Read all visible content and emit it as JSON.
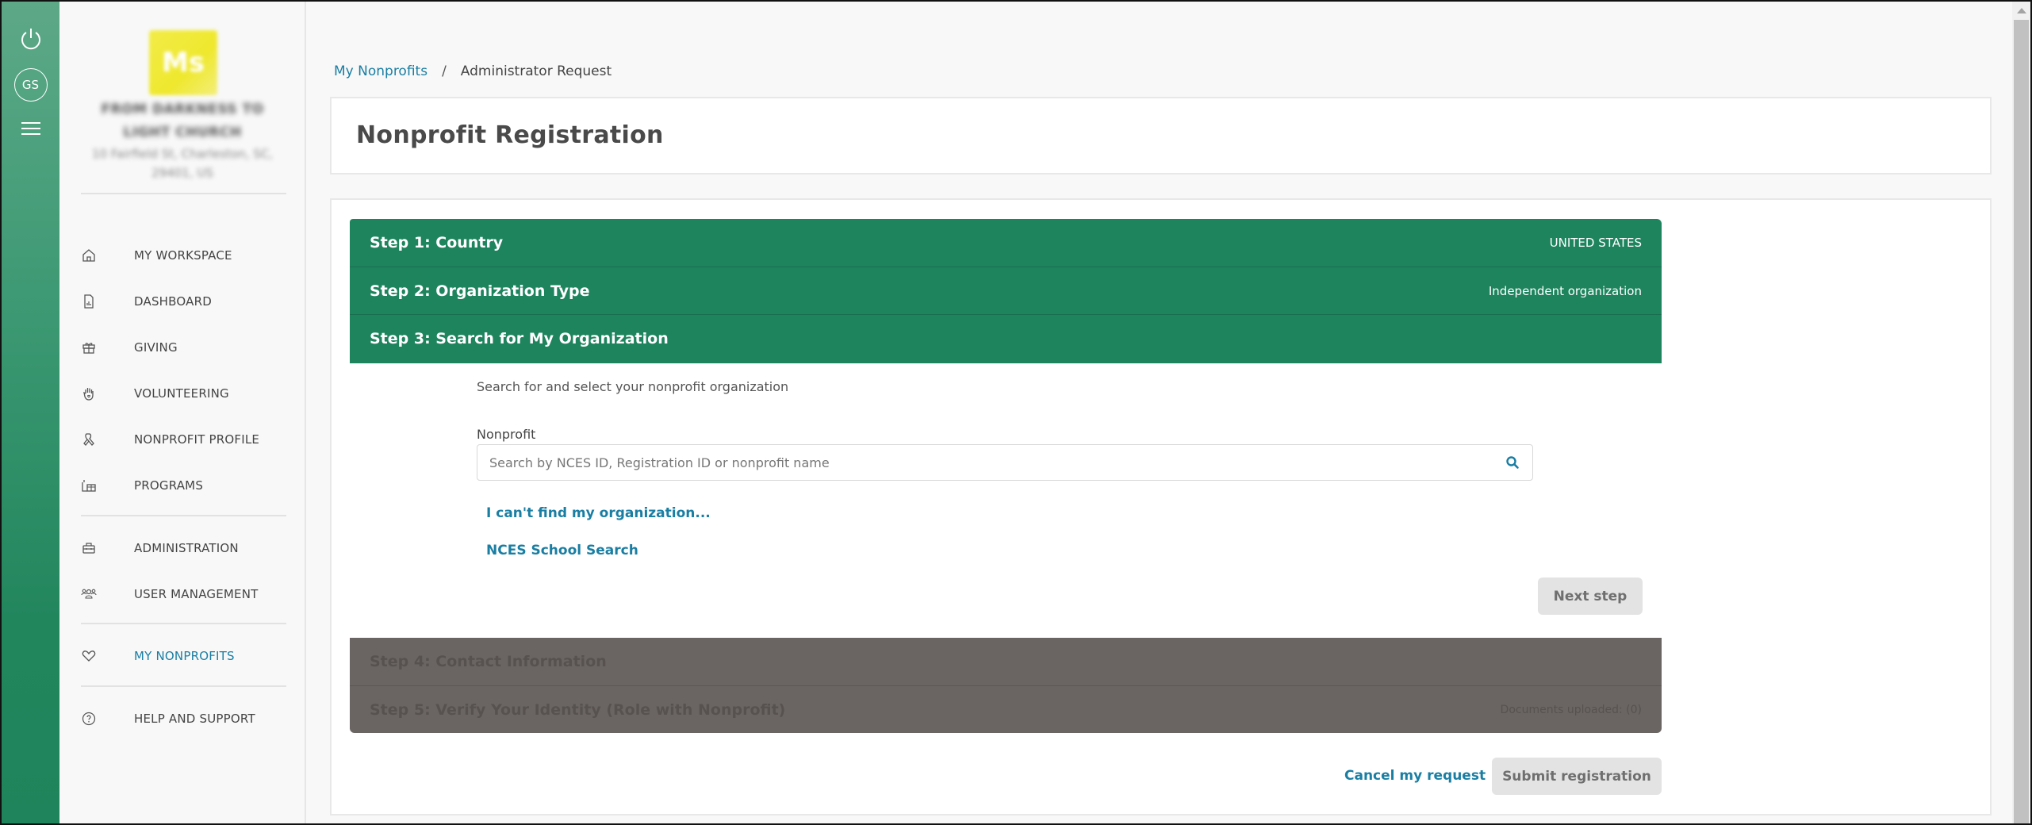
{
  "rail": {
    "avatar_initials": "GS",
    "icons": [
      "power-icon",
      "avatar",
      "hamburger-menu-icon"
    ]
  },
  "sidebar": {
    "org": {
      "logo_glyph": "Ms",
      "name": "FROM DARKNESS TO LIGHT CHURCH",
      "address": "10 Fairfield St, Charleston, SC, 29401, US"
    },
    "items": [
      {
        "label": "MY WORKSPACE",
        "icon": "home-icon",
        "active": false
      },
      {
        "label": "DASHBOARD",
        "icon": "report-icon",
        "active": false
      },
      {
        "label": "GIVING",
        "icon": "gift-icon",
        "active": false
      },
      {
        "label": "VOLUNTEERING",
        "icon": "raised-hand-icon",
        "active": false
      },
      {
        "label": "NONPROFIT PROFILE",
        "icon": "ribbon-icon",
        "active": false
      },
      {
        "label": "PROGRAMS",
        "icon": "programs-icon",
        "active": false
      },
      {
        "label": "ADMINISTRATION",
        "icon": "briefcase-icon",
        "active": false
      },
      {
        "label": "USER MANAGEMENT",
        "icon": "users-icon",
        "active": false
      },
      {
        "label": "MY NONPROFITS",
        "icon": "heart-icon",
        "active": true
      },
      {
        "label": "HELP AND SUPPORT",
        "icon": "help-icon",
        "active": false
      }
    ]
  },
  "breadcrumb": {
    "parent": "My Nonprofits",
    "separator": "/",
    "current": "Administrator Request"
  },
  "page": {
    "title": "Nonprofit Registration"
  },
  "steps": [
    {
      "title": "Step 1: Country",
      "value": "UNITED STATES",
      "state": "completed"
    },
    {
      "title": "Step 2: Organization Type",
      "value": "Independent organization",
      "state": "completed"
    },
    {
      "title": "Step 3: Search for My Organization",
      "value": "",
      "state": "active"
    },
    {
      "title": "Step 4: Contact Information",
      "value": "",
      "state": "disabled"
    },
    {
      "title": "Step 5: Verify Your Identity (Role with Nonprofit)",
      "value": "Documents uploaded: (0)",
      "state": "disabled"
    }
  ],
  "step3": {
    "instruction": "Search for and select your nonprofit organization",
    "field_label": "Nonprofit",
    "search_value": "",
    "search_placeholder": "Search by NCES ID, Registration ID or nonprofit name",
    "cant_find_link": "I can't find my organization...",
    "nces_link": "NCES School Search",
    "next_button": "Next step"
  },
  "footer": {
    "cancel_link": "Cancel my request",
    "submit_button": "Submit registration"
  },
  "colors": {
    "brand_green": "#1e845e",
    "link_blue": "#1a7ea3",
    "disabled_step": "#6a6563",
    "disabled_button": "#e3e3e3"
  }
}
